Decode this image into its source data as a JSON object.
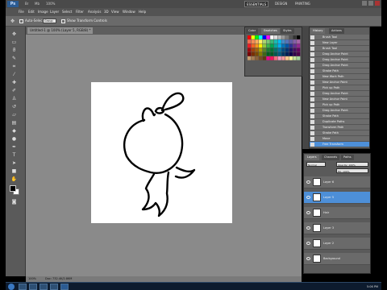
{
  "app": {
    "logo": "Ps",
    "mini_labels": [
      "Br",
      "Mb",
      "100%"
    ],
    "workspaces": [
      "ESSENTIALS",
      "DESIGN",
      "PAINTING"
    ],
    "active_workspace": 0
  },
  "menu": {
    "items": [
      "File",
      "Edit",
      "Image",
      "Layer",
      "Select",
      "Filter",
      "Analysis",
      "3D",
      "View",
      "Window",
      "Help"
    ]
  },
  "options": {
    "auto_select": "Auto-Select:",
    "auto_select_value": "Group",
    "show_transform": "Show Transform Controls"
  },
  "document": {
    "tab_label": "Untitled-1 @ 100% (Layer 5, RGB/8) *",
    "zoom": "100%",
    "doc_size": "Doc: 732.4K/2.86M"
  },
  "swatches": {
    "tabs": [
      "Color",
      "Swatches",
      "Styles"
    ],
    "colors": [
      "#ff0000",
      "#ffff00",
      "#00ff00",
      "#00ffff",
      "#0000ff",
      "#ff00ff",
      "#ffffff",
      "#dddddd",
      "#bbbbbb",
      "#999999",
      "#777777",
      "#555555",
      "#333333",
      "#000000",
      "#f26c4f",
      "#f68e55",
      "#fbaf5c",
      "#fff467",
      "#acd372",
      "#7cc576",
      "#3bb878",
      "#1abbb4",
      "#00bff3",
      "#438ccb",
      "#5574b9",
      "#605ca8",
      "#855fa8",
      "#a763a8",
      "#ed1c24",
      "#f26522",
      "#f7941d",
      "#fff200",
      "#8dc73f",
      "#39b54a",
      "#00a651",
      "#00a99d",
      "#00aeef",
      "#0072bc",
      "#0054a6",
      "#2e3192",
      "#662d91",
      "#92278f",
      "#9e0b0f",
      "#a0410d",
      "#a36209",
      "#aba000",
      "#598527",
      "#1a7b30",
      "#007236",
      "#00746b",
      "#0076a3",
      "#004b80",
      "#003471",
      "#1b1464",
      "#440e62",
      "#630460",
      "#790000",
      "#7b2e00",
      "#7d4900",
      "#827b00",
      "#406618",
      "#005e20",
      "#005826",
      "#005952",
      "#005b7f",
      "#003663",
      "#002157",
      "#0d004c",
      "#32004b",
      "#4b0049",
      "#c69c6d",
      "#a67c52",
      "#8c6239",
      "#754c24",
      "#603913",
      "#ec008c",
      "#ed145b",
      "#f26d7d",
      "#f49ac1",
      "#f5989d",
      "#fdc68a",
      "#fff799",
      "#c4df9b",
      "#a3d39c"
    ]
  },
  "history": {
    "tabs": [
      "History",
      "Actions"
    ],
    "items": [
      {
        "label": "Brush Tool"
      },
      {
        "label": "New Layer"
      },
      {
        "label": "Brush Tool"
      },
      {
        "label": "Drag Anchor Point"
      },
      {
        "label": "Drag Anchor Point"
      },
      {
        "label": "Drag Anchor Point"
      },
      {
        "label": "Stroke Path"
      },
      {
        "label": "New Work Path"
      },
      {
        "label": "New Anchor Point"
      },
      {
        "label": "Pick up Path"
      },
      {
        "label": "Drag Anchor Point"
      },
      {
        "label": "New Anchor Point"
      },
      {
        "label": "Pick up Path"
      },
      {
        "label": "Drag Anchor Point"
      },
      {
        "label": "Stroke Path"
      },
      {
        "label": "Duplicate Paths"
      },
      {
        "label": "Transform Path"
      },
      {
        "label": "Stroke Path"
      },
      {
        "label": "Move"
      },
      {
        "label": "Free Transform"
      }
    ],
    "selected_index": 19
  },
  "layers": {
    "tabs": [
      "Layers",
      "Channels",
      "Paths"
    ],
    "mode": "Normal",
    "opacity": "Opacity: 100%",
    "fill": "Fill: 100%",
    "items": [
      {
        "name": "Layer 6",
        "selected": false
      },
      {
        "name": "Layer 5",
        "selected": true
      },
      {
        "name": "Hair",
        "selected": false
      },
      {
        "name": "Layer 3",
        "selected": false
      },
      {
        "name": "Layer 2",
        "selected": false
      },
      {
        "name": "Background",
        "selected": false
      }
    ]
  },
  "taskbar": {
    "clock": "5:06 PM"
  }
}
